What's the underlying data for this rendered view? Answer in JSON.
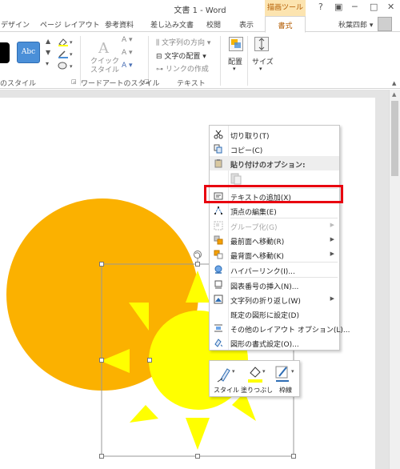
{
  "app": {
    "window_title": "文書 1 - Word",
    "drawing_tools_label": "描画ツール",
    "window_buttons": [
      "?",
      "▣",
      "─",
      "□",
      "✕"
    ],
    "user_name": "秋葉四郎",
    "user_caret": "▾"
  },
  "tabs": [
    {
      "label": "デザイン"
    },
    {
      "label": "ページ レイアウト"
    },
    {
      "label": "参考資料"
    },
    {
      "label": "差し込み文書"
    },
    {
      "label": "校閲"
    },
    {
      "label": "表示"
    },
    {
      "label": "書式",
      "active": true
    }
  ],
  "ribbon": {
    "shape_style_sample": "Abc",
    "quick_style_label": "クイック\nスタイル",
    "text_direction": "文字列の方向",
    "text_align": "文字の配置",
    "create_link": "リンクの作成",
    "arrange": "配置",
    "size": "サイズ",
    "groups": {
      "shape_styles": "のスタイル",
      "wordart_styles": "ワードアートのスタイル",
      "text": "テキスト"
    }
  },
  "context_menu": {
    "items": [
      {
        "label": "切り取り(T)",
        "icon": "scissors-icon"
      },
      {
        "label": "コピー(C)",
        "icon": "copy-icon"
      },
      {
        "label": "貼り付けのオプション:",
        "icon": "paste-icon",
        "header": true
      },
      {
        "label": "テキストの追加(X)",
        "icon": "text-box-icon"
      },
      {
        "label": "頂点の編集(E)",
        "icon": "edit-points-icon"
      },
      {
        "label": "グループ化(G)",
        "icon": "group-icon",
        "disabled": true,
        "submenu": true
      },
      {
        "label": "最前面へ移動(R)",
        "icon": "bring-front-icon",
        "submenu": true
      },
      {
        "label": "最背面へ移動(K)",
        "icon": "send-back-icon",
        "submenu": true
      },
      {
        "label": "ハイパーリンク(I)...",
        "icon": "hyperlink-icon"
      },
      {
        "label": "図表番号の挿入(N)...",
        "icon": "caption-icon"
      },
      {
        "label": "文字列の折り返し(W)",
        "icon": "wrap-text-icon",
        "submenu": true
      },
      {
        "label": "既定の図形に設定(D)",
        "icon": ""
      },
      {
        "label": "その他のレイアウト オプション(L)...",
        "icon": "layout-options-icon"
      },
      {
        "label": "図形の書式設定(O)...",
        "icon": "format-shape-icon"
      }
    ]
  },
  "mini_toolbar": {
    "style": "スタイル",
    "fill": "塗りつぶし",
    "outline": "枠線"
  },
  "colors": {
    "circle_orange": "#fbb100",
    "sun_yellow": "#ffff00",
    "highlight_red": "#e8000f",
    "tool_header_bg": "#fce4b0",
    "tool_header_text": "#b35b00"
  }
}
